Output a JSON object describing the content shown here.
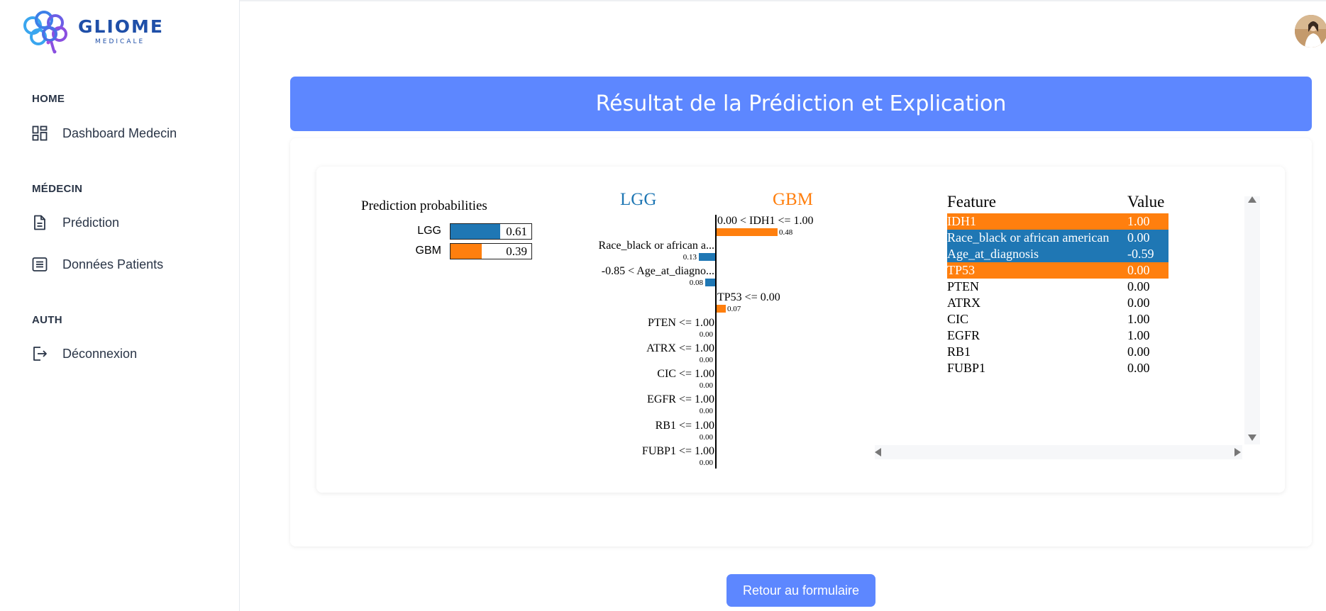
{
  "brand": {
    "title": "GLIOME",
    "subtitle": "MEDICALE"
  },
  "sidebar": {
    "sections": [
      {
        "title": "HOME",
        "items": [
          {
            "label": "Dashboard Medecin",
            "icon": "dashboard-icon"
          }
        ]
      },
      {
        "title": "MÉDECIN",
        "items": [
          {
            "label": "Prédiction",
            "icon": "file-text-icon"
          },
          {
            "label": "Données Patients",
            "icon": "list-icon"
          }
        ]
      },
      {
        "title": "AUTH",
        "items": [
          {
            "label": "Déconnexion",
            "icon": "logout-icon"
          }
        ]
      }
    ]
  },
  "header": {
    "title": "Résultat de la Prédiction et Explication"
  },
  "prediction": {
    "title": "Prediction probabilities",
    "rows": [
      {
        "label": "LGG",
        "value": 0.61,
        "value_text": "0.61",
        "color": "#1f77b4"
      },
      {
        "label": "GBM",
        "value": 0.39,
        "value_text": "0.39",
        "color": "#ff7f0e"
      }
    ]
  },
  "explanation": {
    "class_left": "LGG",
    "class_right": "GBM",
    "colors": {
      "left": "#1f77b4",
      "right": "#ff7f0e"
    },
    "features": [
      {
        "text": "0.00 < IDH1 <= 1.00",
        "weight": 0.48,
        "weight_text": "0.48",
        "side": "right"
      },
      {
        "text": "Race_black or african a...",
        "weight": 0.13,
        "weight_text": "0.13",
        "side": "left"
      },
      {
        "text": "-0.85 < Age_at_diagno...",
        "weight": 0.08,
        "weight_text": "0.08",
        "side": "left"
      },
      {
        "text": "TP53 <= 0.00",
        "weight": 0.07,
        "weight_text": "0.07",
        "side": "right"
      },
      {
        "text": "PTEN <= 1.00",
        "weight": 0.0,
        "weight_text": "0.00",
        "side": "left"
      },
      {
        "text": "ATRX <= 1.00",
        "weight": 0.0,
        "weight_text": "0.00",
        "side": "left"
      },
      {
        "text": "CIC <= 1.00",
        "weight": 0.0,
        "weight_text": "0.00",
        "side": "left"
      },
      {
        "text": "EGFR <= 1.00",
        "weight": 0.0,
        "weight_text": "0.00",
        "side": "left"
      },
      {
        "text": "RB1 <= 1.00",
        "weight": 0.0,
        "weight_text": "0.00",
        "side": "left"
      },
      {
        "text": "FUBP1 <= 1.00",
        "weight": 0.0,
        "weight_text": "0.00",
        "side": "left"
      }
    ]
  },
  "table": {
    "headers": [
      "Feature",
      "Value"
    ],
    "rows": [
      {
        "feature": "IDH1",
        "value": "1.00",
        "highlight": "#ff7f0e"
      },
      {
        "feature": "Race_black or african american",
        "value": "0.00",
        "highlight": "#1f77b4"
      },
      {
        "feature": "Age_at_diagnosis",
        "value": "-0.59",
        "highlight": "#1f77b4"
      },
      {
        "feature": "TP53",
        "value": "0.00",
        "highlight": "#ff7f0e"
      },
      {
        "feature": "PTEN",
        "value": "0.00",
        "highlight": ""
      },
      {
        "feature": "ATRX",
        "value": "0.00",
        "highlight": ""
      },
      {
        "feature": "CIC",
        "value": "1.00",
        "highlight": ""
      },
      {
        "feature": "EGFR",
        "value": "1.00",
        "highlight": ""
      },
      {
        "feature": "RB1",
        "value": "0.00",
        "highlight": ""
      },
      {
        "feature": "FUBP1",
        "value": "0.00",
        "highlight": ""
      }
    ]
  },
  "actions": {
    "back_label": "Retour au formulaire"
  }
}
